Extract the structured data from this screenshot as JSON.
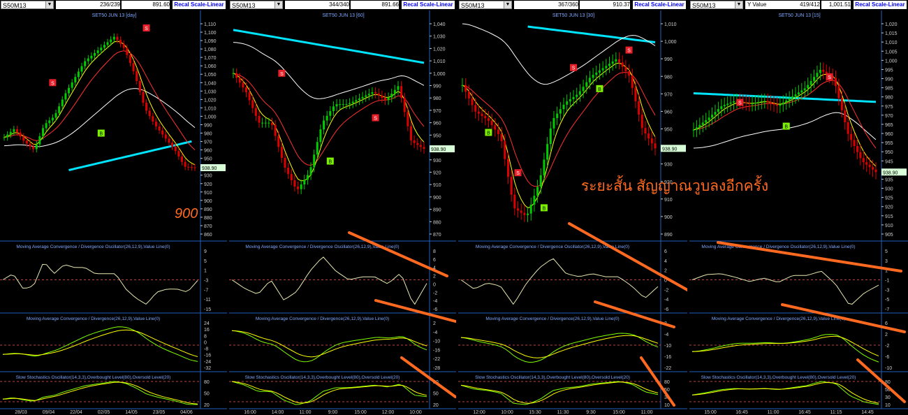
{
  "colors": {
    "ma_fast": "#ffff00",
    "ma_mid": "#ff3030",
    "ma_long": "#ffffff",
    "ma_trend": "#00e5ff",
    "signal": "#ffff00",
    "macd": "#e8e8b0",
    "hist": "#7fff00",
    "annot": "#ff6a20",
    "axis": "#cfcfcf",
    "title": "#7fa8ff",
    "up": "#00cc00",
    "down": "#dd0000",
    "marker_s": "#e8202a",
    "marker_b": "#7cf000",
    "price_tag": "#d8ffd8"
  },
  "annotation": {
    "thai_text": "ระยะสั้น สัญญาณวูบลงอีกครั้ง",
    "level_900": "900"
  },
  "panels": [
    {
      "symbol": "S50M13",
      "info_a": "236/239",
      "info_b": "891.60",
      "recal": "Recal Scale-Linear",
      "title": "SET50 JUN 13  [day]",
      "last_price": "938.90",
      "price_ticks": [
        "1,110",
        "1,100",
        "1,090",
        "1,080",
        "1,070",
        "1,060",
        "1,050",
        "1,040",
        "1,030",
        "1,020",
        "1,010",
        "1,000",
        "990",
        "980",
        "970",
        "960",
        "950",
        "940",
        "930",
        "920",
        "910",
        "900",
        "890",
        "880",
        "870",
        "860"
      ],
      "macd_osc_title": "Moving Average Convergence / Divergence Oscillator(26,12,9),Value Line(0)",
      "macd_osc_ticks": [
        "9",
        "5",
        "1",
        "-3",
        "-7",
        "-11",
        "-15"
      ],
      "macd_title": "Moving Average Convergence / Divergence(26,12,9),Value Line(0)",
      "macd_ticks": [
        "24",
        "16",
        "8",
        "0",
        "-8",
        "-16",
        "-24",
        "-32"
      ],
      "stoch_title": "Slow Stochastics Oscillator(14,3,3),Overbought Level(80),Oversold Level(20)",
      "stoch_ticks": [
        "80",
        "50",
        "20"
      ],
      "time_labels": [
        "28/03",
        "09/04",
        "22/04",
        "02/05",
        "14/05",
        "23/05",
        "04/06"
      ]
    },
    {
      "symbol": "S50M13",
      "info_a": "344/340",
      "info_b": "891.66",
      "recal": "Recal Scale-Linear",
      "title": "SET50 JUN 13   [60]",
      "last_price": "938.90",
      "price_ticks": [
        "1,040",
        "1,030",
        "1,020",
        "1,010",
        "1,000",
        "990",
        "980",
        "970",
        "960",
        "950",
        "940",
        "930",
        "920",
        "910",
        "900",
        "890",
        "880",
        "870"
      ],
      "macd_osc_title": "Moving Average Convergence / Divergence Oscillator(26,12,9),Value Line(0)",
      "macd_osc_ticks": [
        "8",
        "6",
        "4",
        "2",
        "0",
        "-2",
        "-4",
        "-6"
      ],
      "macd_title": "Moving Average Convergence / Divergence(26,12,9),Value Line(0)",
      "macd_ticks": [
        "2",
        "-4",
        "-10",
        "-16",
        "-22",
        "-28"
      ],
      "stoch_title": "Slow Stochastics Oscillator(14,3,3),Overbought Level(80),Oversold Level(20)",
      "stoch_ticks": [
        "80",
        "50",
        "20"
      ],
      "time_labels": [
        "16:00",
        "14:00",
        "11:00",
        "9:00",
        "15:00",
        "12:00",
        "10:00"
      ]
    },
    {
      "symbol": "S50M13",
      "info_a": "367/360",
      "info_b": "910.37",
      "recal": "Recal Scale-Linear",
      "title": "SET50 JUN 13   [30]",
      "last_price": "938.90",
      "price_ticks": [
        "1,010",
        "1,000",
        "990",
        "980",
        "970",
        "960",
        "950",
        "940",
        "930",
        "920",
        "910",
        "900",
        "890"
      ],
      "macd_osc_title": "Moving Average Convergence / Divergence Oscillator(26,12,9),Value Line(0)",
      "macd_osc_ticks": [
        "6",
        "4",
        "2",
        "0",
        "-2",
        "-4",
        "-6"
      ],
      "macd_title": "Moving Average Convergence / Divergence(26,12,9),Value Line(0)",
      "macd_ticks": [
        "2",
        "-4",
        "-10",
        "-16",
        "-22"
      ],
      "stoch_title": "Slow Stochastics Oscillator(14,3,3),Overbought Level(80),Oversold Level(20)",
      "stoch_ticks": [
        "80",
        "50",
        "30",
        "10"
      ],
      "time_labels": [
        "12:00",
        "10:00",
        "15:30",
        "11:30",
        "9:30",
        "15:00",
        "11:00"
      ]
    },
    {
      "symbol": "S50M13",
      "info_a": "419/412",
      "info_b": "1,001.51",
      "recal": "Recal Scale-Linear",
      "yvalue_label": "Y Value",
      "title": "SET50 JUN 13   [15]",
      "last_price": "938.90",
      "price_ticks": [
        "1,020",
        "1,015",
        "1,010",
        "1,005",
        "1,000",
        "995",
        "990",
        "985",
        "980",
        "975",
        "970",
        "965",
        "960",
        "955",
        "950",
        "945",
        "940",
        "935",
        "930",
        "925",
        "920",
        "915",
        "910",
        "905"
      ],
      "macd_osc_title": "Moving Average Convergence / Divergence Oscillator(26,12,9),Value Line(0)",
      "macd_osc_ticks": [
        "5",
        "3",
        "1",
        "-1",
        "-3",
        "-5",
        "-7"
      ],
      "macd_title": "Moving Average Convergence / Divergence(26,12,9),Value Line(0)",
      "macd_ticks": [
        "6",
        "2",
        "-2",
        "-6",
        "-10"
      ],
      "stoch_title": "Slow Stochastics Oscillator(14,3,3),Overbought Level(80),Oversold Level(20)",
      "stoch_ticks": [
        "80",
        "50",
        "30",
        "10"
      ],
      "time_labels": [
        "15:00",
        "16:45",
        "11:00",
        "16:45",
        "11:15",
        "14:45"
      ]
    }
  ],
  "chart_data": [
    {
      "type": "line",
      "timeframe": "day",
      "ylim": [
        860,
        1110
      ],
      "overbought": 80,
      "oversold": 20,
      "series": [
        {
          "name": "close",
          "values": [
            975,
            985,
            970,
            960,
            990,
            1000,
            1025,
            1045,
            1065,
            1075,
            1085,
            1095,
            1080,
            1050,
            1010,
            990,
            975,
            960,
            940,
            938.9
          ]
        }
      ],
      "markers": [
        {
          "type": "S",
          "value": 1040
        },
        {
          "type": "B",
          "value": 980
        },
        {
          "type": "S",
          "value": 1105
        }
      ],
      "annotations": [
        "900"
      ]
    },
    {
      "type": "line",
      "timeframe": "60",
      "ylim": [
        870,
        1040
      ],
      "overbought": 80,
      "oversold": 20,
      "series": [
        {
          "name": "close",
          "values": [
            1000,
            985,
            960,
            960,
            925,
            905,
            920,
            960,
            975,
            975,
            980,
            985,
            978,
            990,
            945,
            938.9
          ]
        }
      ],
      "markers": [
        {
          "type": "S",
          "value": 1000
        },
        {
          "type": "B",
          "value": 929
        },
        {
          "type": "S",
          "value": 964
        }
      ]
    },
    {
      "type": "line",
      "timeframe": "30",
      "ylim": [
        885,
        1015
      ],
      "overbought": 80,
      "oversold": 20,
      "series": [
        {
          "name": "close",
          "values": [
            975,
            960,
            955,
            945,
            905,
            900,
            920,
            955,
            965,
            970,
            980,
            985,
            990,
            980,
            950,
            938.9
          ]
        }
      ],
      "markers": [
        {
          "type": "B",
          "value": 948
        },
        {
          "type": "S",
          "value": 925
        },
        {
          "type": "B",
          "value": 905
        },
        {
          "type": "S",
          "value": 985
        },
        {
          "type": "B",
          "value": 973
        },
        {
          "type": "S",
          "value": 995
        }
      ],
      "annotations": [
        "ระยะสั้น สัญญาณวูบลงอีกครั้ง"
      ]
    },
    {
      "type": "line",
      "timeframe": "15",
      "ylim": [
        905,
        1020
      ],
      "overbought": 80,
      "oversold": 20,
      "series": [
        {
          "name": "close",
          "values": [
            962,
            968,
            975,
            978,
            976,
            978,
            975,
            980,
            985,
            995,
            990,
            960,
            945,
            938.9
          ]
        }
      ],
      "markers": [
        {
          "type": "S",
          "value": 977
        },
        {
          "type": "B",
          "value": 964
        },
        {
          "type": "S",
          "value": 991
        }
      ]
    }
  ]
}
